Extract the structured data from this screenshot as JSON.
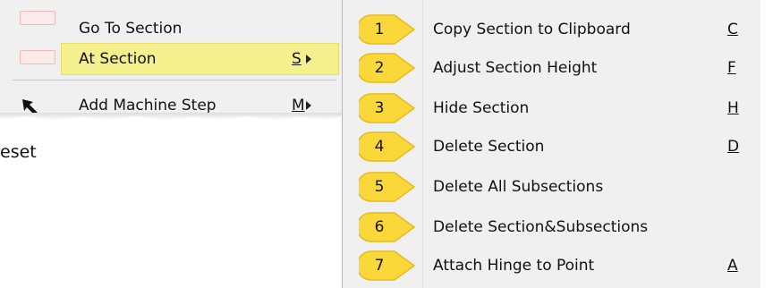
{
  "parent_menu": {
    "items": [
      {
        "label": "Go To Section",
        "shortcut": "",
        "has_submenu": false
      },
      {
        "label": "At Section",
        "shortcut": "S",
        "has_submenu": true,
        "highlighted": true
      },
      {
        "label": "Add Machine Step",
        "shortcut": "M",
        "has_submenu": true
      }
    ]
  },
  "background_text": "eset",
  "submenu": {
    "items": [
      {
        "badge": "1",
        "label": "Copy Section to Clipboard",
        "shortcut": "C"
      },
      {
        "badge": "2",
        "label": "Adjust Section Height",
        "shortcut": "F"
      },
      {
        "badge": "3",
        "label": "Hide Section",
        "shortcut": "H"
      },
      {
        "badge": "4",
        "label": "Delete Section",
        "shortcut": "D"
      },
      {
        "badge": "5",
        "label": "Delete All Subsections",
        "shortcut": ""
      },
      {
        "badge": "6",
        "label": "Delete Section&Subsections",
        "shortcut": ""
      },
      {
        "badge": "7",
        "label": "Attach Hinge to Point",
        "shortcut": "A"
      }
    ]
  },
  "colors": {
    "highlight": "#f4f08e",
    "badge_fill": "#fbd83a",
    "menu_bg": "#f0f0f0"
  }
}
